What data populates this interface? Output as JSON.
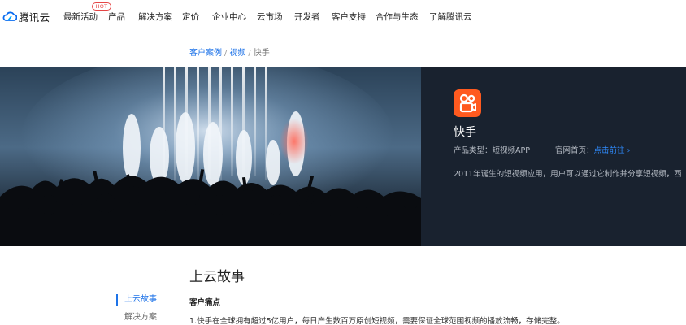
{
  "nav": {
    "logo_text": "腾讯云",
    "hot_badge": "HOT",
    "items": [
      "最新活动",
      "产品",
      "解决方案",
      "定价",
      "企业中心",
      "云市场",
      "开发者",
      "客户支持",
      "合作与生态",
      "了解腾讯云"
    ]
  },
  "breadcrumb": {
    "items": [
      "客户案例",
      "视频",
      "快手"
    ],
    "separator": "/"
  },
  "hero": {
    "app_name": "快手",
    "product_type_label": "产品类型：",
    "product_type_value": "短视频APP",
    "website_label": "官网首页：",
    "website_link": "点击前往",
    "website_arrow": "›",
    "description": "2011年诞生的短视频应用，用户可以通过它制作并分享短视频，西"
  },
  "story": {
    "title": "上云故事",
    "sidebar": [
      "上云故事",
      "解决方案"
    ],
    "section_heading": "客户痛点",
    "paragraph": "1.快手在全球拥有超过5亿用户，每日产生数百万原创短视频，需要保证全球范围视频的播放流畅，存储完整。"
  },
  "colors": {
    "accent": "#1e73e8",
    "hero_bg": "#19222f",
    "app_icon": "#ff5a1f",
    "hot": "#e54545"
  }
}
